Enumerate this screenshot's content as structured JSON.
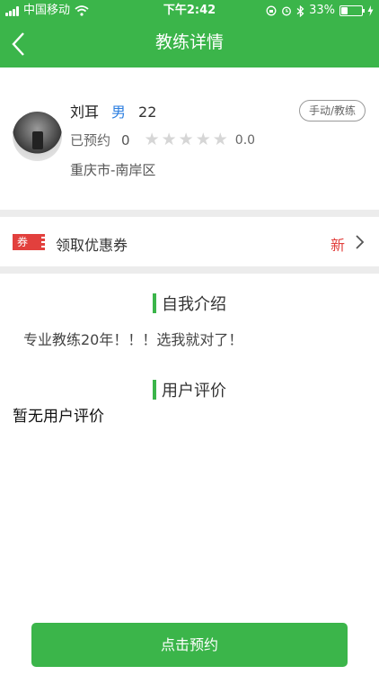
{
  "status_bar": {
    "carrier": "中国移动",
    "time": "下午2:42",
    "battery": "33%",
    "battery_level": 0.33
  },
  "nav": {
    "title": "教练详情"
  },
  "coach": {
    "name": "刘耳",
    "gender": "男",
    "age": "22",
    "tag": "手动/教练",
    "booked_label": "已预约",
    "booked_count": "0",
    "rating": "0.0",
    "stars_filled": 0,
    "stars_total": 5,
    "location": "重庆市-南岸区"
  },
  "coupon": {
    "icon_text": "券",
    "label": "领取优惠券",
    "badge": "新"
  },
  "intro": {
    "title": "自我介绍",
    "text": "专业教练20年！！！选我就对了！"
  },
  "reviews": {
    "title": "用户评价",
    "empty_text": "暂无用户评价"
  },
  "book_button": {
    "label": "点击预约"
  },
  "colors": {
    "primary": "#3bb54a",
    "accent_red": "#e2403d",
    "gender_blue": "#2d7fe0",
    "divider": "#ececec"
  }
}
